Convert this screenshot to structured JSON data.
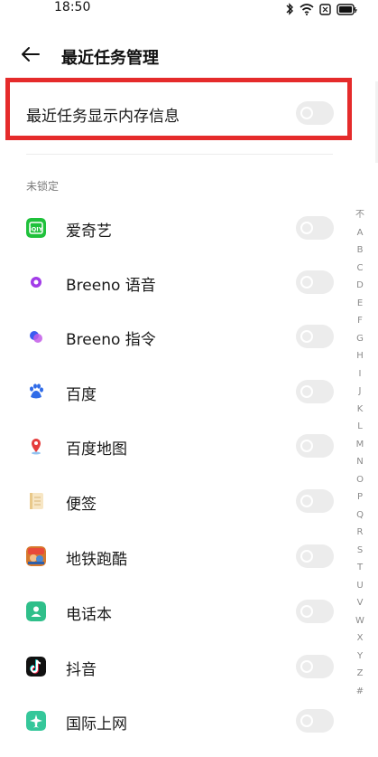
{
  "status_bar": {
    "time": "18:50"
  },
  "header": {
    "title": "最近任务管理"
  },
  "memory_setting": {
    "label": "最近任务显示内存信息",
    "enabled": false
  },
  "section": {
    "label": "未锁定"
  },
  "apps": [
    {
      "name": "爱奇艺",
      "icon": "iqiyi-icon",
      "color": "#1fc13b",
      "enabled": false
    },
    {
      "name": "Breeno 语音",
      "icon": "breeno-voice-icon",
      "color": "#a23ce8",
      "enabled": false
    },
    {
      "name": "Breeno 指令",
      "icon": "breeno-command-icon",
      "color": "#5b6cf0",
      "enabled": false
    },
    {
      "name": "百度",
      "icon": "baidu-icon",
      "color": "#2f6be8",
      "enabled": false
    },
    {
      "name": "百度地图",
      "icon": "baidu-map-icon",
      "color": "#e53c3c",
      "enabled": false
    },
    {
      "name": "便签",
      "icon": "notes-icon",
      "color": "#f3d9a8",
      "enabled": false
    },
    {
      "name": "地铁跑酷",
      "icon": "subway-surfers-icon",
      "color": "#d6792c",
      "enabled": false
    },
    {
      "name": "电话本",
      "icon": "contacts-icon",
      "color": "#2fbf8a",
      "enabled": false
    },
    {
      "name": "抖音",
      "icon": "douyin-icon",
      "color": "#111111",
      "enabled": false
    },
    {
      "name": "国际上网",
      "icon": "global-internet-icon",
      "color": "#35c79a",
      "enabled": false
    }
  ],
  "index_letters": [
    "不",
    "A",
    "B",
    "C",
    "D",
    "E",
    "F",
    "G",
    "H",
    "I",
    "J",
    "K",
    "L",
    "M",
    "N",
    "O",
    "P",
    "Q",
    "R",
    "S",
    "T",
    "U",
    "V",
    "W",
    "X",
    "Y",
    "Z",
    "#"
  ]
}
